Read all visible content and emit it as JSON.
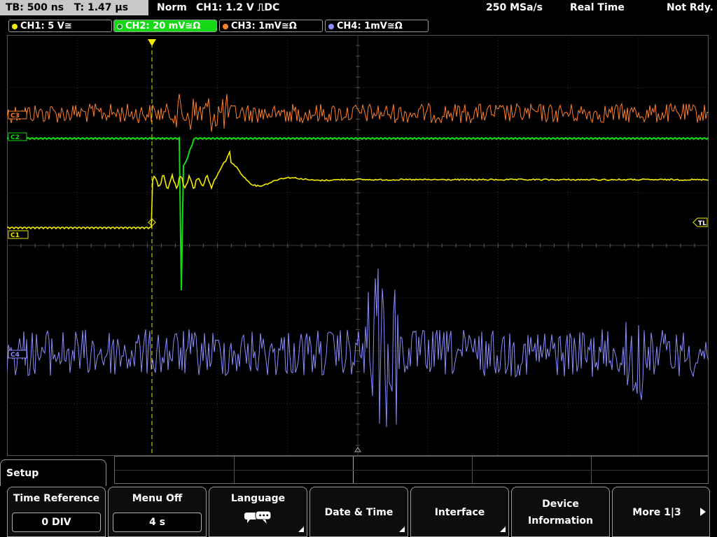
{
  "status": {
    "timebase": "TB: 500 ns",
    "trigger_time": "T: 1.47 µs",
    "mode": "Norm",
    "trigger_setting": "CH1: 1.2 V",
    "trigger_edge": "⎍DC",
    "sample_rate": "250 MSa/s",
    "acq_mode": "Real Time",
    "ready_state": "Not Rdy."
  },
  "channels": [
    {
      "label": "CH1: 5 V≅",
      "color": "#f2ec00",
      "active": false
    },
    {
      "label": "CH2: 20 mV≅Ω",
      "color": "#16d916",
      "active": true
    },
    {
      "label": "CH3: 1mV≅Ω",
      "color": "#ff7f2a",
      "active": false
    },
    {
      "label": "CH4: 1mV≅Ω",
      "color": "#8c8cff",
      "active": false
    }
  ],
  "markers": {
    "trigger_level_label": "TL",
    "ch1_label": "C1",
    "ch2_label": "C2",
    "ch3_label": "C3",
    "ch4_label": "C4"
  },
  "menu": {
    "section": "Setup",
    "softkeys": [
      {
        "label": "Time Reference",
        "value": "0 DIV"
      },
      {
        "label": "Menu Off",
        "value": "4 s"
      },
      {
        "label": "Language",
        "icon": "speech-bubbles-icon"
      },
      {
        "label": "Date & Time"
      },
      {
        "label": "Interface"
      },
      {
        "label_line1": "Device",
        "label_line2": "Information"
      },
      {
        "label": "More 1|3"
      }
    ]
  }
}
